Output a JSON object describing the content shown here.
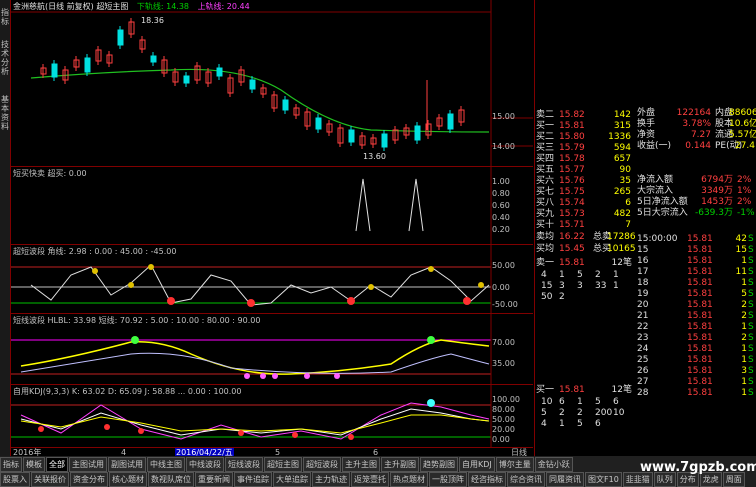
{
  "side_labels": {
    "a": "指标",
    "b": "技术分析",
    "c": "基本资料"
  },
  "title": {
    "name": "金洲慈航(日线 前复权) 超短主图",
    "lower_label": "下轨线: 14.38",
    "upper_label": "上轨线: 20.44",
    "high": "18.36",
    "low": "13.60"
  },
  "main_axis": [
    "15.00",
    "14.00"
  ],
  "panel2": {
    "title": "短买快卖 超买: 0.00",
    "axis": [
      "1.00",
      "0.80",
      "0.60",
      "0.40",
      "0.20"
    ]
  },
  "panel3": {
    "title": "超短波段 角线: 2.98 : 0.00 : 45.00 : -45.00",
    "axis": [
      "50.00",
      "0.00",
      "-50.00"
    ]
  },
  "panel4": {
    "title": "短线波段 HLBL: 33.98 短线: 70.92 : 5.00 : 10.00 : 80.00 : 90.00",
    "axis": [
      "70.00",
      "35.00"
    ]
  },
  "panel5": {
    "title": "自用KDJ(9,3,3) K: 63.02 D: 65.09 J: 58.88 ... 0.00 : 100.00",
    "axis": [
      "100.00",
      "80.00",
      "50.00",
      "20.00",
      "0.00"
    ]
  },
  "date_axis": {
    "left": "2016年",
    "mid": "2016/04/22/五",
    "right": "日线",
    "m4": "4",
    "m5": "5",
    "m6": "6"
  },
  "orderbook": {
    "sell_rows": [
      {
        "label": "卖二",
        "price": "15.82",
        "vol": "142"
      },
      {
        "label": "买一",
        "price": "15.81",
        "vol": "315"
      },
      {
        "label": "买二",
        "price": "15.80",
        "vol": "1336"
      },
      {
        "label": "买三",
        "price": "15.79",
        "vol": "594"
      },
      {
        "label": "买四",
        "price": "15.78",
        "vol": "657"
      },
      {
        "label": "买五",
        "price": "15.77",
        "vol": "90"
      },
      {
        "label": "买六",
        "price": "15.76",
        "vol": "35"
      },
      {
        "label": "买七",
        "price": "15.75",
        "vol": "265"
      },
      {
        "label": "买八",
        "price": "15.74",
        "vol": "6"
      },
      {
        "label": "买九",
        "price": "15.73",
        "vol": "482"
      },
      {
        "label": "买十",
        "price": "15.71",
        "vol": "7"
      }
    ],
    "avg_sell": {
      "label": "卖均",
      "price": "16.22",
      "tlabel": "总卖",
      "tval": "17286"
    },
    "avg_buy": {
      "label": "买均",
      "price": "15.45",
      "tlabel": "总买",
      "tval": "10165"
    }
  },
  "stats": [
    {
      "k": "外盘",
      "v": "122164",
      "k2": "内盘",
      "v2": "88606"
    },
    {
      "k": "换手",
      "v": "3.78%",
      "k2": "股本",
      "v2": "10.6亿"
    },
    {
      "k": "净资",
      "v": "7.27",
      "k2": "流通",
      "v2": "5.57亿"
    },
    {
      "k": "收益(一)",
      "v": "0.144",
      "k2": "PE(动)",
      "v2": "27.4"
    }
  ],
  "flows": [
    {
      "k": "净流入额",
      "v": "6794万",
      "p": "2%"
    },
    {
      "k": "大宗流入",
      "v": "3349万",
      "p": "1%"
    },
    {
      "k": "5日净流入额",
      "v": "1453万",
      "p": "2%"
    },
    {
      "k": "5日大宗流入",
      "v": "-639.3万",
      "p": "-1%"
    }
  ],
  "ticks": [
    {
      "t": "15:00:00",
      "p": "15.81",
      "v": "42",
      "s": "S"
    },
    {
      "t": "15",
      "p": "15.81",
      "v": "15",
      "s": "S"
    },
    {
      "t": "16",
      "p": "15.81",
      "v": "1",
      "s": "S"
    },
    {
      "t": "17",
      "p": "15.81",
      "v": "11",
      "s": "S"
    },
    {
      "t": "18",
      "p": "15.81",
      "v": "1",
      "s": "S"
    },
    {
      "t": "19",
      "p": "15.81",
      "v": "5",
      "s": "S"
    },
    {
      "t": "20",
      "p": "15.81",
      "v": "2",
      "s": "S"
    },
    {
      "t": "21",
      "p": "15.81",
      "v": "2",
      "s": "S"
    },
    {
      "t": "22",
      "p": "15.81",
      "v": "1",
      "s": "S"
    },
    {
      "t": "23",
      "p": "15.81",
      "v": "2",
      "s": "S"
    },
    {
      "t": "24",
      "p": "15.81",
      "v": "1",
      "s": "S"
    },
    {
      "t": "25",
      "p": "15.81",
      "v": "1",
      "s": "S"
    },
    {
      "t": "26",
      "p": "15.81",
      "v": "3",
      "s": "S"
    },
    {
      "t": "27",
      "p": "15.81",
      "v": "1",
      "s": "S"
    },
    {
      "t": "28",
      "p": "15.81",
      "v": "1",
      "s": "S"
    }
  ],
  "queue1": {
    "label": "卖一",
    "price": "15.81",
    "cnt": "12笔",
    "r1": [
      "4",
      "1",
      "5",
      "2",
      "1"
    ],
    "r2": [
      "15",
      "3",
      "3",
      "33",
      "1"
    ],
    "r3": [
      "50",
      "2"
    ]
  },
  "queue2": {
    "label": "买一",
    "price": "15.81",
    "cnt": "12笔",
    "r1": [
      "10",
      "6",
      "1",
      "5",
      "6"
    ],
    "r2": [
      "5",
      "2",
      "2",
      "200",
      "10"
    ],
    "r3": [
      "4",
      "1",
      "5",
      "6"
    ]
  },
  "tabs_row1": [
    "指标",
    "模板",
    "全部",
    "主图试用",
    "副图试用",
    "中线主图",
    "中线波段",
    "短线波段",
    "超短主图",
    "超短波段",
    "主升主图",
    "主升副图",
    "趋势副图",
    "自用KDJ",
    "博尔主量",
    "金钻小跃"
  ],
  "tabs_row2": [
    "股票入",
    "关联报价",
    "资金分布",
    "核心题材",
    "数视队席位",
    "重要新闻",
    "事件追踪",
    "大单追踪",
    "主力轨迹",
    "返笼壹托",
    "热点题材",
    "一股顶阵",
    "经咨指标",
    "综合资讯",
    "同履资讯",
    "图文F10",
    "韭韭猫",
    "队列",
    "分布",
    "龙虎",
    "周面"
  ],
  "watermark": "www.7gpzb.com"
}
